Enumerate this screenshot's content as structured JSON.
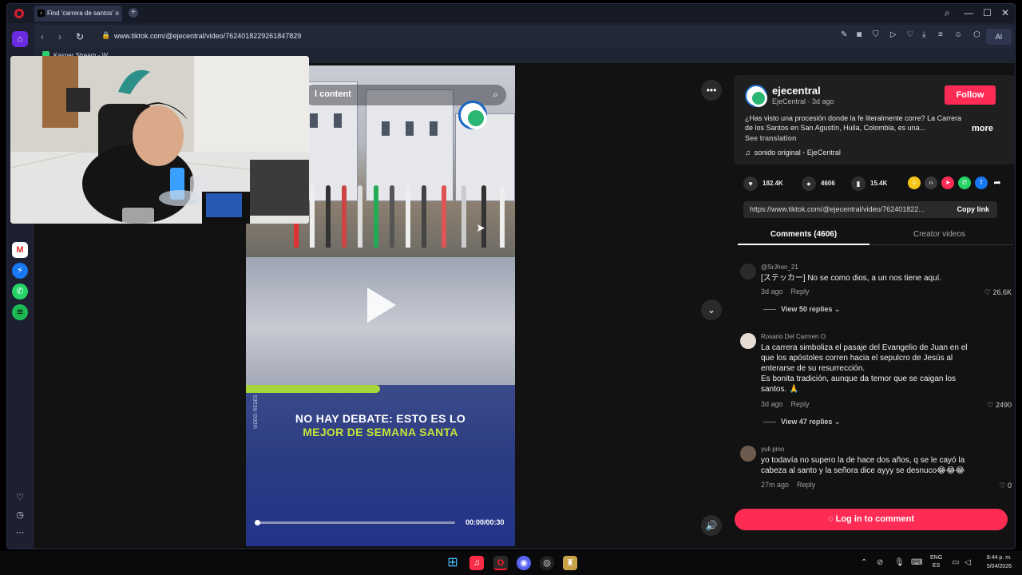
{
  "browser": {
    "tab_title": "Find 'carrera de santos' o",
    "url": "www.tiktok.com/@ejecentral/video/7624018229261847829",
    "bookmark": "Kasper Stream - W...",
    "ai_label": "AI"
  },
  "video": {
    "search_text": "l content",
    "caption_line1": "NO HAY DEBATE: ESTO ES LO",
    "caption_line2": "MEJOR DE SEMANA SANTA",
    "credit": "VIDEO: REDES",
    "time": "00:00/00:30",
    "progress": 0.0
  },
  "post": {
    "author_name": "ejecentral",
    "author_meta": "EjeCentral · 3d ago",
    "follow_label": "Follow",
    "description": "¿Has visto una procesión donde la fe literalmente corre? La Carrera de los Santos en San Agustín, Huila, Colombia, es una...",
    "more_label": "more",
    "see_translation": "See translation",
    "sound": "sonido original - EjeCentral",
    "likes": "182.4K",
    "comments": "4606",
    "saves": "15.4K",
    "link": "https://www.tiktok.com/@ejecentral/video/762401822...",
    "copy_link_label": "Copy link"
  },
  "tabs": {
    "comments": "Comments (4606)",
    "creator": "Creator videos"
  },
  "comments": [
    {
      "user": "@SrJhon_21",
      "text": "[ステッカー] No se como dios, a un nos tiene aquí.",
      "time": "3d ago",
      "reply": "Reply",
      "likes": "26.6K",
      "view_replies": "View 50 replies"
    },
    {
      "user": "Rosario Del Carmen O",
      "text": "La carrera simboliza el pasaje del Evangelio de Juan en el que los apóstoles corren hacia el sepulcro de Jesús al enterarse de su resurrección.",
      "text2": "Es bonita tradición, aunque da temor que se caigan los santos. 🙏",
      "time": "3d ago",
      "reply": "Reply",
      "likes": "2490",
      "view_replies": "View 47 replies"
    },
    {
      "user": "yuli pino",
      "text": "yo todavía no supero la de hace dos años, q se le cayó la cabeza al santo y la señora dice ayyy se desnuco😂😂😂",
      "time": "27m ago",
      "reply": "Reply",
      "likes": "0"
    }
  ],
  "login_label": "Log in to comment",
  "taskbar": {
    "lang_line1": "ENG",
    "lang_line2": "ES",
    "time": "8:44 p. m.",
    "date": "5/04/2026"
  },
  "colors": {
    "accent": "#fe2c55",
    "caption_green": "#c6e33b"
  }
}
